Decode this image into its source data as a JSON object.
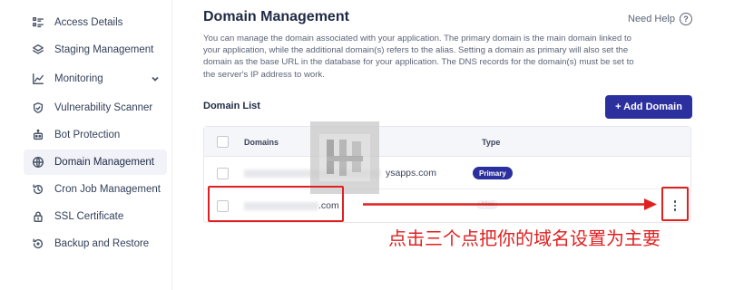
{
  "sidebar": {
    "items": [
      {
        "label": "Access Details",
        "icon": "key-icon"
      },
      {
        "label": "Staging Management",
        "icon": "layers-icon"
      },
      {
        "label": "Monitoring",
        "icon": "chart-icon"
      },
      {
        "label": "Vulnerability Scanner",
        "icon": "shield-scan-icon"
      },
      {
        "label": "Bot Protection",
        "icon": "robot-icon"
      },
      {
        "label": "Domain Management",
        "icon": "globe-www-icon"
      },
      {
        "label": "Cron Job Management",
        "icon": "clock-history-icon"
      },
      {
        "label": "SSL Certificate",
        "icon": "lock-icon"
      },
      {
        "label": "Backup and Restore",
        "icon": "restore-icon"
      }
    ],
    "active_index": 5
  },
  "main": {
    "title": "Domain Management",
    "need_help": "Need Help",
    "description": "You can manage the domain associated with your application. The primary domain is the main domain linked to your application, while the additional domain(s) refers to the alias. Setting a domain as primary will also set the domain as the base URL in the database for your application. The DNS records for the domain(s) must be set to the server's IP address to work.",
    "list_title": "Domain List",
    "add_button": "+ Add Domain",
    "table": {
      "columns": [
        "Domains",
        "Type"
      ],
      "rows": [
        {
          "domain": "ysapps.com",
          "type": "Primary"
        },
        {
          "domain": ".com",
          "type": "Alias"
        }
      ]
    }
  },
  "annotation": {
    "text": "点击三个点把你的域名设置为主要",
    "color": "#e02020"
  },
  "colors": {
    "accent": "#2c2f9e",
    "annotation": "#e02020"
  }
}
